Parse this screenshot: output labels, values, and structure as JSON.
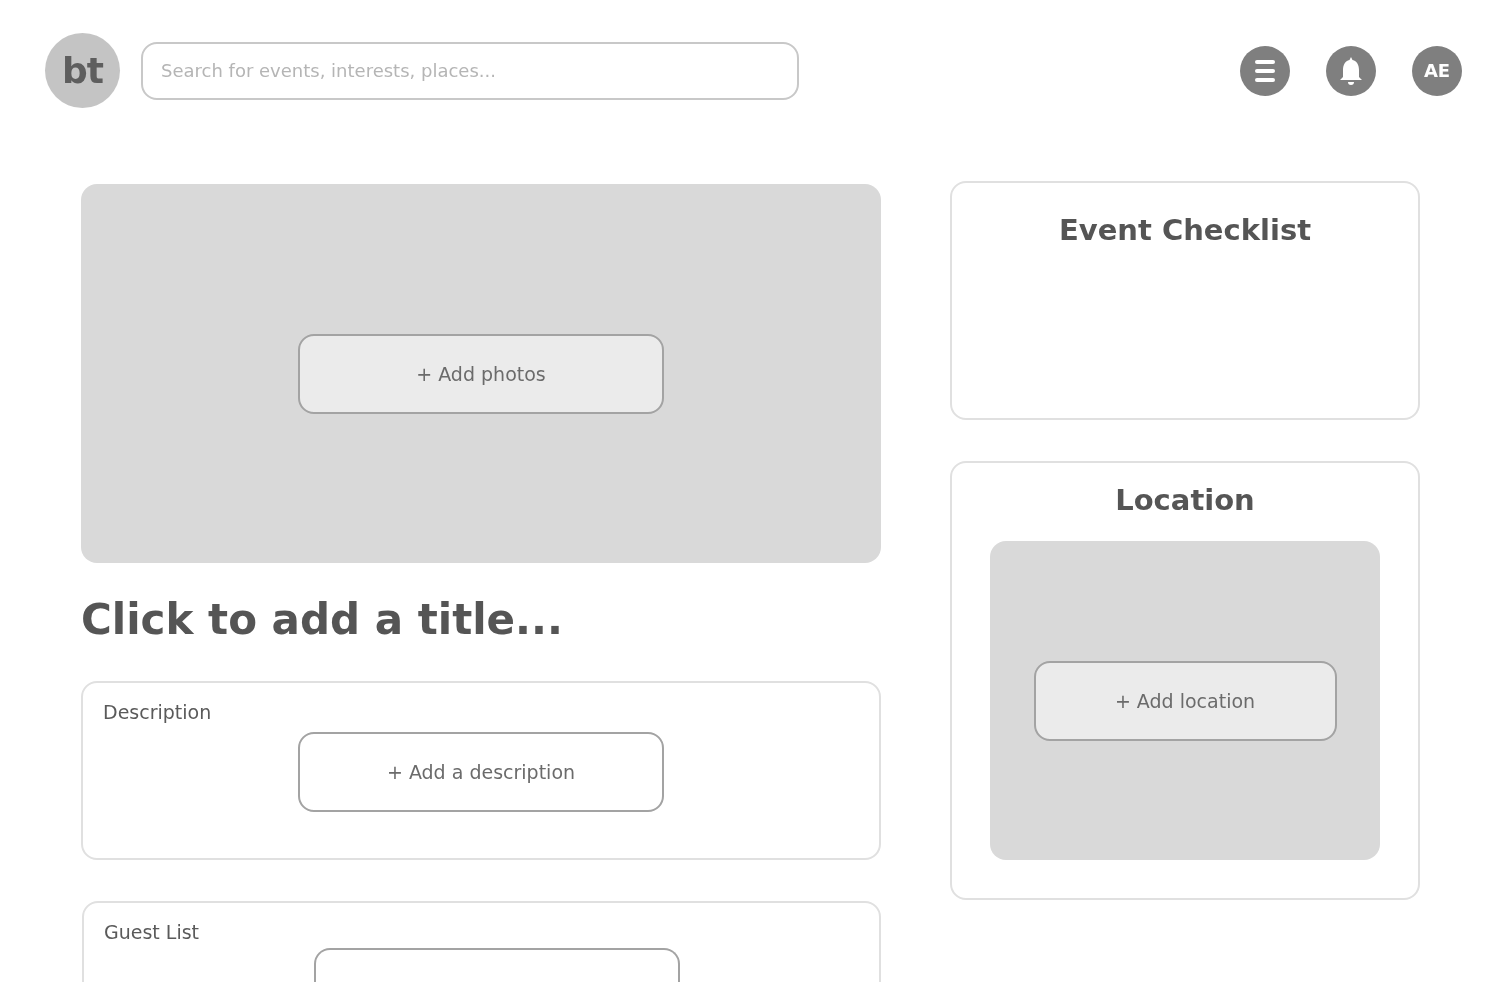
{
  "header": {
    "logo": "bt",
    "search": {
      "placeholder": "Search for events, interests, places..."
    },
    "avatar": "AE"
  },
  "photos": {
    "button": "+ Add photos"
  },
  "title": "Click to add a title...",
  "description": {
    "label": "Description",
    "button": "+ Add a description"
  },
  "guest_list": {
    "label": "Guest List"
  },
  "checklist": {
    "title": "Event Checklist"
  },
  "location": {
    "title": "Location",
    "button": "+ Add location"
  }
}
